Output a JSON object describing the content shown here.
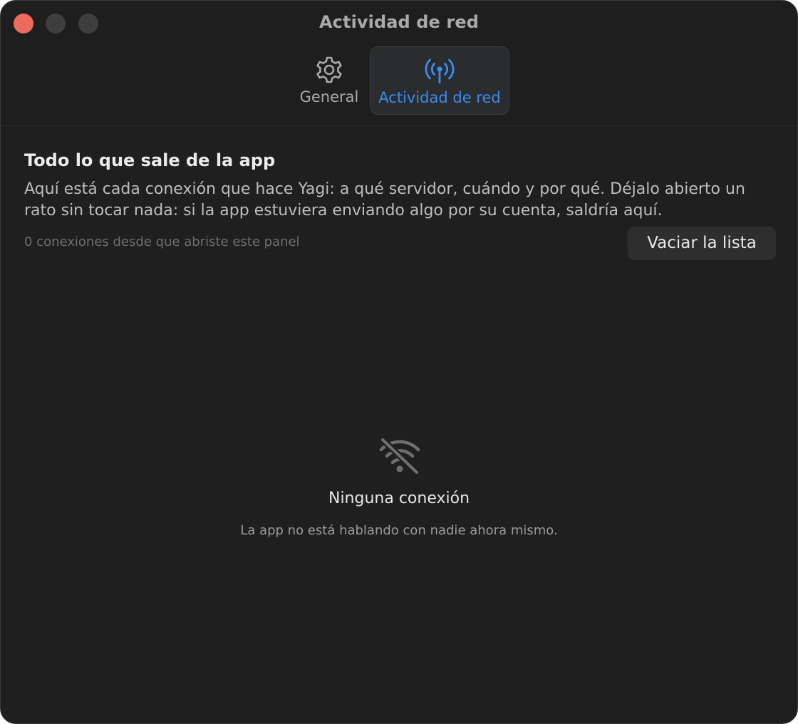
{
  "window": {
    "title": "Actividad de red"
  },
  "tabs": [
    {
      "label": "General",
      "icon": "gear-icon",
      "selected": false
    },
    {
      "label": "Actividad de red",
      "icon": "antenna-icon",
      "selected": true
    }
  ],
  "section": {
    "heading": "Todo lo que sale de la app",
    "description": "Aquí está cada conexión que hace Yagi: a qué servidor, cuándo y por qué. Déjalo abierto un rato sin tocar nada: si la app estuviera enviando algo por su cuenta, saldría aquí.",
    "count_text": "0 conexiones desde que abriste este panel",
    "clear_button": "Vaciar la lista"
  },
  "empty_state": {
    "icon": "wifi-off-icon",
    "title": "Ninguna conexión",
    "subtitle": "La app no está hablando con nadie ahora mismo."
  },
  "colors": {
    "accent": "#3b8cf3",
    "close_button": "#ed6a5e",
    "window_background": "#1f1f1f"
  }
}
